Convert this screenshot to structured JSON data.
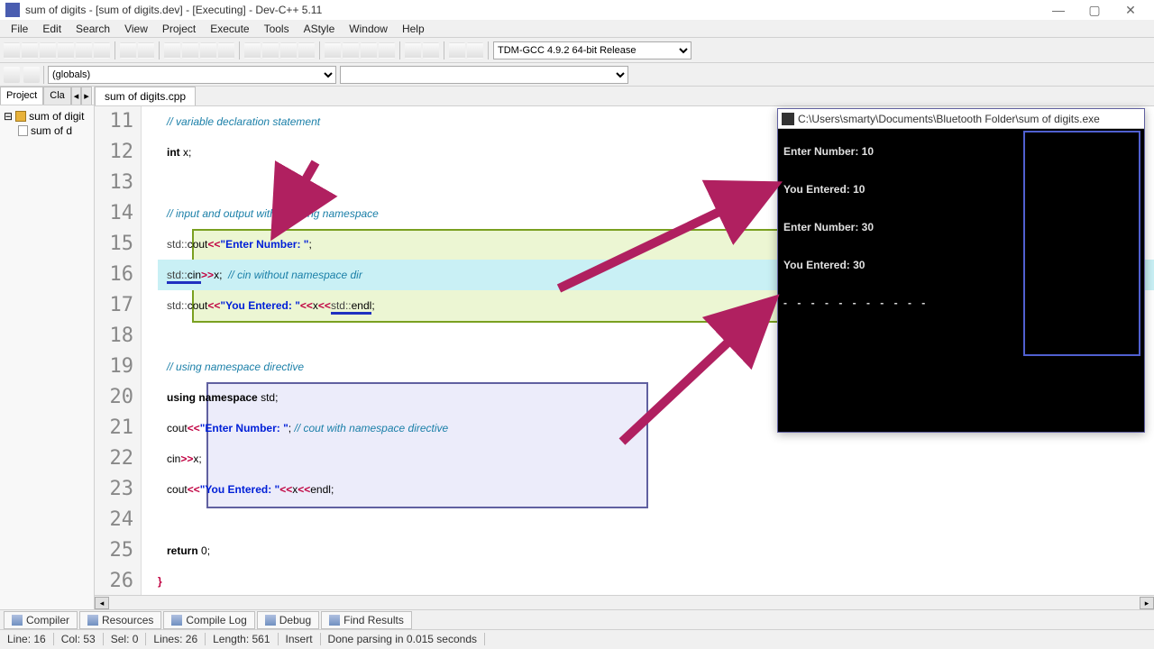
{
  "window": {
    "title": "sum of digits - [sum of digits.dev] - [Executing] - Dev-C++ 5.11"
  },
  "menu": [
    "File",
    "Edit",
    "Search",
    "View",
    "Project",
    "Execute",
    "Tools",
    "AStyle",
    "Window",
    "Help"
  ],
  "compiler_select": "TDM-GCC 4.9.2 64-bit Release",
  "classbar_select": "(globals)",
  "sidebar": {
    "tabs": [
      "Project",
      "Cla"
    ],
    "project_name": "sum of digit",
    "file_name": "sum of d"
  },
  "editor": {
    "tab": "sum of digits.cpp",
    "lines": {
      "l11": "// variable declaration statement",
      "l12_kw": "int",
      "l12_rest": " x;",
      "l14": "// input and output without using namespace",
      "l15_ns": "std::",
      "l15_out": "cout",
      "l15_op1": "<<",
      "l15_str": "\"Enter Number: \"",
      "l15_end": ";",
      "l16_ns": "std::",
      "l16_in": "cin",
      "l16_op": ">>",
      "l16_var": "x;  ",
      "l16_cmt": "// cin without namespace dir",
      "l17_ns1": "std::",
      "l17_out": "cout",
      "l17_op1": "<<",
      "l17_str": "\"You Entered: \"",
      "l17_op2": "<<",
      "l17_var": "x",
      "l17_op3": "<<",
      "l17_ns2": "std::",
      "l17_endl": "endl",
      "l17_end": ";",
      "l19": "// using namespace directive",
      "l20": "using namespace",
      "l20_std": " std;",
      "l21_out": "cout",
      "l21_op1": "<<",
      "l21_str": "\"Enter Number: \"",
      "l21_end": "; ",
      "l21_cmt": "// cout with namespace directive",
      "l22_in": "cin",
      "l22_op": ">>",
      "l22_var": "x;",
      "l23_out": "cout",
      "l23_op1": "<<",
      "l23_str": "\"You Entered: \"",
      "l23_op2": "<<",
      "l23_var": "x",
      "l23_op3": "<<",
      "l23_endl": "endl;",
      "l25_kw": "return",
      "l25_rest": " 0;",
      "l26": "}"
    },
    "line_numbers": [
      "11",
      "12",
      "13",
      "14",
      "15",
      "16",
      "17",
      "18",
      "19",
      "20",
      "21",
      "22",
      "23",
      "24",
      "25",
      "26"
    ]
  },
  "console": {
    "title": "C:\\Users\\smarty\\Documents\\Bluetooth Folder\\sum of digits.exe",
    "lines": [
      "Enter Number: 10",
      "You Entered: 10",
      "Enter Number: 30",
      "You Entered: 30",
      "",
      "- - - - - - - - - - -"
    ]
  },
  "bottom_tabs": [
    "Compiler",
    "Resources",
    "Compile Log",
    "Debug",
    "Find Results"
  ],
  "status": {
    "line": "Line:  16",
    "col": "Col:  53",
    "sel": "Sel:  0",
    "lines": "Lines:  26",
    "length": "Length:  561",
    "insert": "Insert",
    "parse": "Done parsing in 0.015 seconds"
  }
}
